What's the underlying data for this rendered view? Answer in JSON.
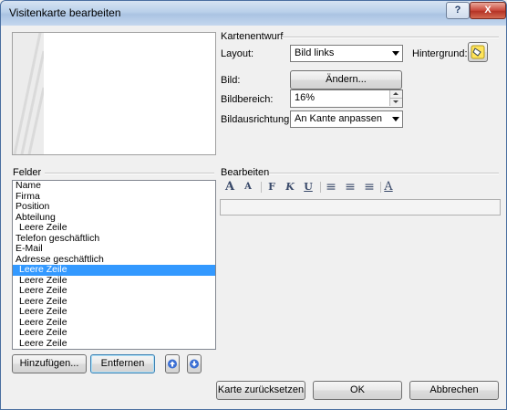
{
  "window": {
    "title": "Visitenkarte bearbeiten",
    "help_glyph": "?",
    "close_glyph": "X"
  },
  "design": {
    "group_title": "Kartenentwurf",
    "layout_label": "Layout:",
    "layout_value": "Bild links",
    "background_label": "Hintergrund:",
    "picture_label": "Bild:",
    "change_button": "Ändern...",
    "area_label": "Bildbereich:",
    "area_value": "16%",
    "alignment_label": "Bildausrichtung:",
    "alignment_value": "An Kante anpassen"
  },
  "fields": {
    "group_title": "Felder",
    "items": [
      {
        "label": "Name",
        "indent": false,
        "selected": false
      },
      {
        "label": "Firma",
        "indent": false,
        "selected": false
      },
      {
        "label": "Position",
        "indent": false,
        "selected": false
      },
      {
        "label": "Abteilung",
        "indent": false,
        "selected": false
      },
      {
        "label": "Leere Zeile",
        "indent": true,
        "selected": false
      },
      {
        "label": "Telefon geschäftlich",
        "indent": false,
        "selected": false
      },
      {
        "label": "E-Mail",
        "indent": false,
        "selected": false
      },
      {
        "label": "Adresse geschäftlich",
        "indent": false,
        "selected": false
      },
      {
        "label": "Leere Zeile",
        "indent": true,
        "selected": true
      },
      {
        "label": "Leere Zeile",
        "indent": true,
        "selected": false
      },
      {
        "label": "Leere Zeile",
        "indent": true,
        "selected": false
      },
      {
        "label": "Leere Zeile",
        "indent": true,
        "selected": false
      },
      {
        "label": "Leere Zeile",
        "indent": true,
        "selected": false
      },
      {
        "label": "Leere Zeile",
        "indent": true,
        "selected": false
      },
      {
        "label": "Leere Zeile",
        "indent": true,
        "selected": false
      },
      {
        "label": "Leere Zeile",
        "indent": true,
        "selected": false
      }
    ],
    "add_button": "Hinzufügen...",
    "remove_button": "Entfernen"
  },
  "edit": {
    "group_title": "Bearbeiten",
    "toolbar": [
      "A",
      "A",
      "F",
      "K",
      "U",
      "≡",
      "≡",
      "≡",
      "A"
    ]
  },
  "footer": {
    "reset_button": "Karte zurücksetzen",
    "ok_button": "OK",
    "cancel_button": "Abbrechen"
  },
  "colors": {
    "selection": "#3399ff",
    "accent_title": "#b9d0ea"
  }
}
